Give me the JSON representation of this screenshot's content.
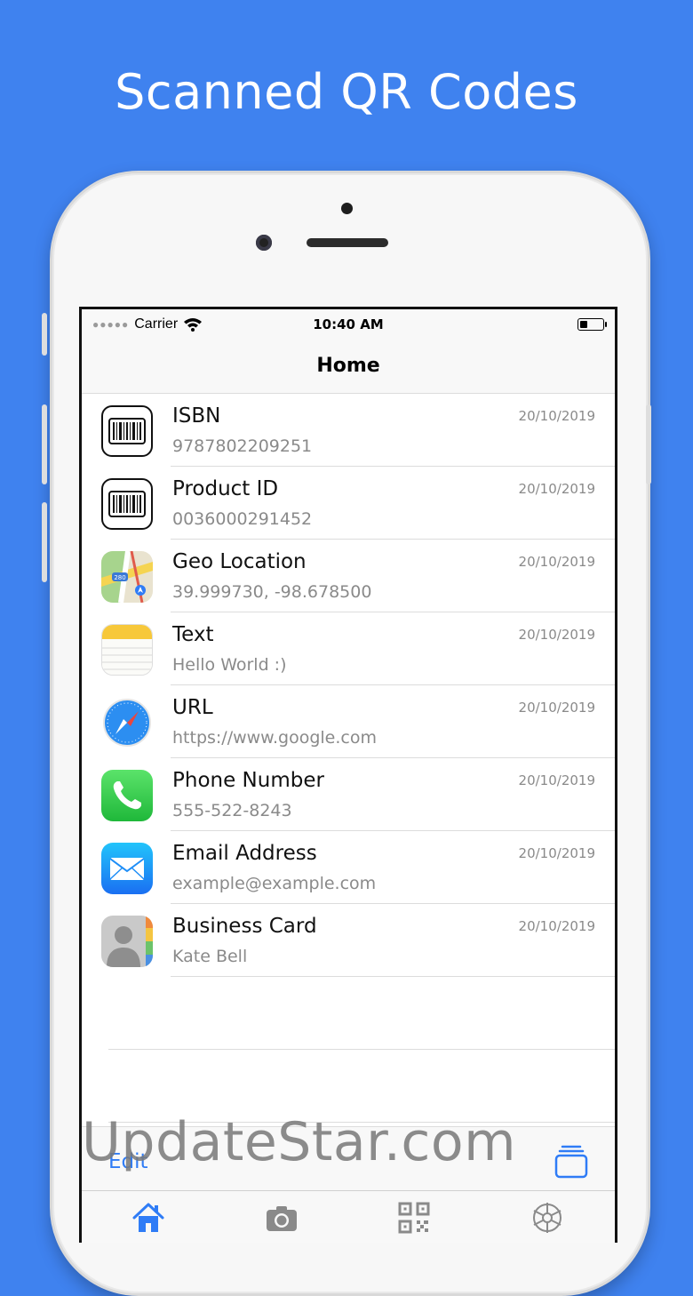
{
  "headline": "Scanned QR Codes",
  "status": {
    "carrier": "Carrier",
    "time": "10:40 AM"
  },
  "nav": {
    "title": "Home"
  },
  "items": [
    {
      "title": "ISBN",
      "subtitle": "9787802209251",
      "date": "20/10/2019",
      "icon": "barcode-icon"
    },
    {
      "title": "Product ID",
      "subtitle": "0036000291452",
      "date": "20/10/2019",
      "icon": "barcode-icon"
    },
    {
      "title": "Geo Location",
      "subtitle": "39.999730, -98.678500",
      "date": "20/10/2019",
      "icon": "maps-icon"
    },
    {
      "title": "Text",
      "subtitle": "Hello World :)",
      "date": "20/10/2019",
      "icon": "notes-icon"
    },
    {
      "title": "URL",
      "subtitle": "https://www.google.com",
      "date": "20/10/2019",
      "icon": "safari-icon"
    },
    {
      "title": "Phone Number",
      "subtitle": "555-522-8243",
      "date": "20/10/2019",
      "icon": "phone-icon"
    },
    {
      "title": "Email Address",
      "subtitle": "example@example.com",
      "date": "20/10/2019",
      "icon": "mail-icon"
    },
    {
      "title": "Business Card",
      "subtitle": "Kate Bell",
      "date": "20/10/2019",
      "icon": "contact-icon"
    }
  ],
  "map_badge": "280",
  "toolbar": {
    "edit_label": "Edit"
  },
  "watermark": "UpdateStar.com",
  "tabs": [
    {
      "name": "home-icon",
      "active": true
    },
    {
      "name": "camera-icon",
      "active": false
    },
    {
      "name": "qr-code-icon",
      "active": false
    },
    {
      "name": "settings-icon",
      "active": false
    }
  ],
  "colors": {
    "background": "#3f82ef",
    "accent": "#2f7cf6",
    "phone_green": "#34c759",
    "mail_blue": "#1e8ef7"
  }
}
